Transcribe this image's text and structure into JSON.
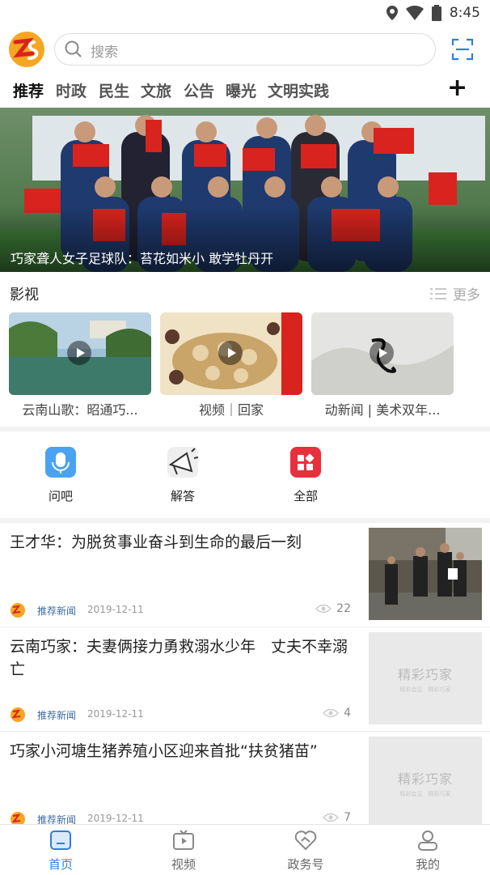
{
  "status": {
    "time": "8:45"
  },
  "search": {
    "placeholder": "搜索"
  },
  "tabs": [
    "推荐",
    "时政",
    "民生",
    "文旅",
    "公告",
    "曝光",
    "文明实践"
  ],
  "hero": {
    "caption": "巧家聋人女子足球队：苔花如米小 敢学牡丹开"
  },
  "video_section": {
    "title": "影视",
    "more": "更多",
    "items": [
      {
        "caption": "云南山歌：昭通巧..."
      },
      {
        "caption": "视频｜回家"
      },
      {
        "caption": "动新闻 | 美术双年..."
      }
    ]
  },
  "functions": [
    {
      "label": "问吧",
      "icon": "microphone-icon"
    },
    {
      "label": "解答",
      "icon": "megaphone-icon"
    },
    {
      "label": "全部",
      "icon": "grid-icon"
    }
  ],
  "news": [
    {
      "title": "王才华：为脱贫事业奋斗到生命的最后一刻",
      "source": "推荐新闻",
      "date": "2019-12-11",
      "views": "22"
    },
    {
      "title": "云南巧家：夫妻俩接力勇救溺水少年　丈夫不幸溺亡",
      "source": "推荐新闻",
      "date": "2019-12-11",
      "views": "4"
    },
    {
      "title": "巧家小河塘生猪养殖小区迎来首批“扶贫猪苗”",
      "source": "推荐新闻",
      "date": "2019-12-11",
      "views": "7"
    }
  ],
  "placeholder": {
    "main": "精彩巧家",
    "sub": "精彩会见　精彩巧家"
  },
  "bottom_nav": [
    "首页",
    "视频",
    "政务号",
    "我的"
  ],
  "colors": {
    "accent": "#2f7fd6",
    "brand_orange": "#f5a623",
    "flag_red": "#d9231e"
  }
}
